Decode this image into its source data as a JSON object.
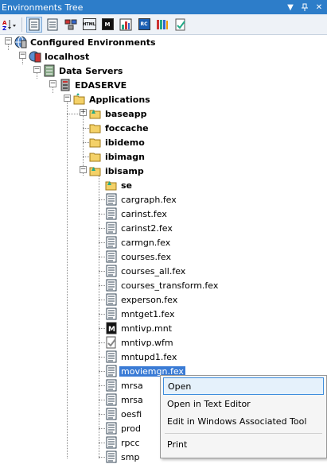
{
  "window": {
    "title": "Environments Tree",
    "controls": [
      "▾",
      "ᵖ",
      "✕"
    ]
  },
  "toolbar": {
    "buttons": [
      {
        "name": "sort-button",
        "glyph": "A↓"
      },
      {
        "name": "view-button-1",
        "glyph": ""
      },
      {
        "name": "view-button-2",
        "glyph": ""
      },
      {
        "name": "view-button-3",
        "glyph": ""
      },
      {
        "name": "html-button",
        "glyph": "HTML"
      },
      {
        "name": "m-button",
        "glyph": "M"
      },
      {
        "name": "r-button",
        "glyph": ""
      },
      {
        "name": "rc-button",
        "glyph": "RC"
      },
      {
        "name": "library-button",
        "glyph": ""
      },
      {
        "name": "check-button",
        "glyph": ""
      }
    ]
  },
  "tree": {
    "configured": "Configured Environments",
    "localhost": "localhost",
    "data_servers": "Data Servers",
    "edaserve": "EDASERVE",
    "applications": "Applications",
    "apps": {
      "baseapp": "baseapp",
      "foccache": "foccache",
      "ibidemo": "ibidemo",
      "ibimagn": "ibimagn",
      "ibisamp": "ibisamp"
    },
    "se": "se",
    "files": [
      "cargraph.fex",
      "carinst.fex",
      "carinst2.fex",
      "carmgn.fex",
      "courses.fex",
      "courses_all.fex",
      "courses_transform.fex",
      "experson.fex",
      "mntget1.fex",
      "mntivp.mnt",
      "mntivp.wfm",
      "mntupd1.fex",
      "moviemgn.fex",
      "mrsa",
      "mrsa",
      "oesfi",
      "prod",
      "rpcc",
      "smp"
    ]
  },
  "context_menu": {
    "items": [
      "Open",
      "Open in Text Editor",
      "Edit in Windows Associated Tool",
      "Print"
    ]
  }
}
